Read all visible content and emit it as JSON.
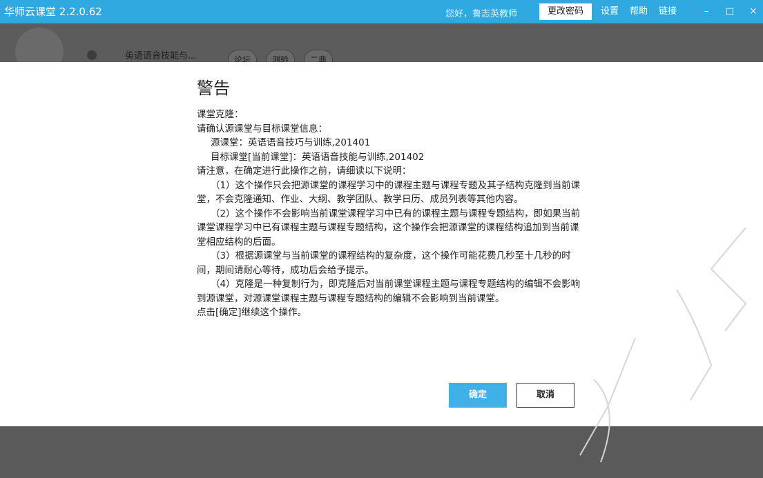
{
  "window": {
    "app_title": "华师云课堂 2.2.0.62",
    "greeting": "您好，鲁志英教师",
    "menu": [
      "更改密码",
      "设置",
      "帮助",
      "链接"
    ],
    "controls": [
      "–",
      "□",
      "×"
    ]
  },
  "background": {
    "course_name": "英语语音技能与...",
    "pills": [
      "论坛",
      "测验",
      "二典"
    ]
  },
  "dialog": {
    "title": "警告",
    "lines": [
      "课堂克隆：",
      "请确认源课堂与目标课堂信息：",
      "源课堂：英语语音技巧与训练,201401",
      "目标课堂[当前课堂]：英语语音技能与训练,201402",
      "请注意，在确定进行此操作之前，请细读以下说明：",
      "（1）这个操作只会把源课堂的课程学习中的课程主题与课程专题及其子结构克隆到当前课堂，不会克隆通知、作业、大纲、教学团队、教学日历、成员列表等其他内容。",
      "（2）这个操作不会影响当前课堂课程学习中已有的课程主题与课程专题结构，即如果当前课堂课程学习中已有课程主题与课程专题结构，这个操作会把源课堂的课程结构追加到当前课堂相应结构的后面。",
      "（3）根据源课堂与当前课堂的课程结构的复杂度，这个操作可能花费几秒至十几秒的时间，期间请耐心等待，成功后会给予提示。",
      "（4）克隆是一种复制行为，即克隆后对当前课堂课程主题与课程专题结构的编辑不会影响到源课堂，对源课堂课程主题与课程专题结构的编辑不会影响到当前课堂。",
      "点击[确定]继续这个操作。"
    ],
    "ok_label": "确定",
    "cancel_label": "取消"
  },
  "colors": {
    "titlebar": "#2fa9e0",
    "ok_button": "#3fb0e8",
    "overlay": "#5a5a5a"
  }
}
